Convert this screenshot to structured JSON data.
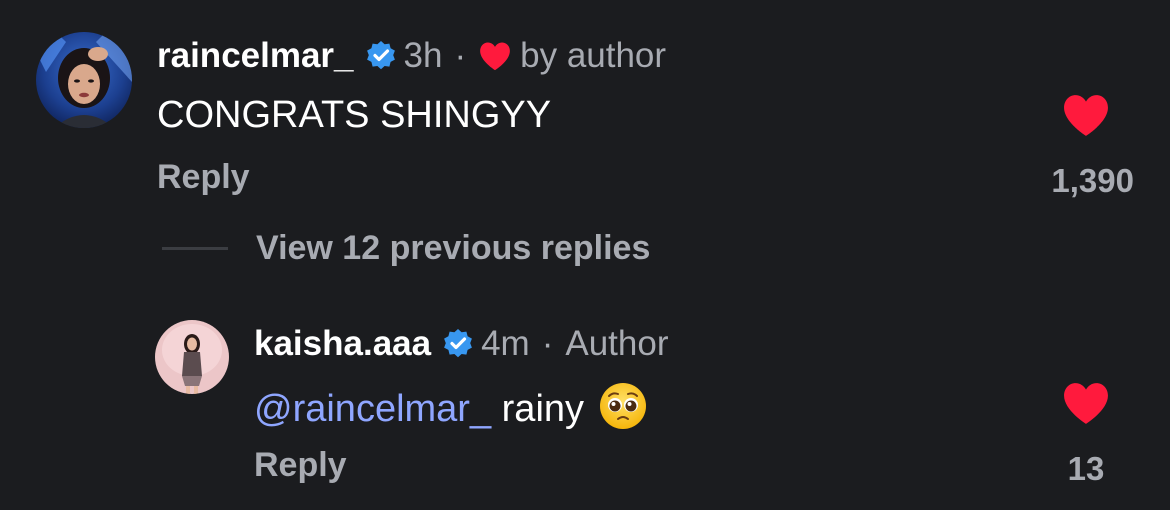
{
  "colors": {
    "background": "#1b1c1f",
    "secondary_text": "#a8abb2",
    "mention": "#8fa6ff",
    "heart": "#ff1a3d",
    "verified": "#3897f0"
  },
  "comments": [
    {
      "username": "raincelmar_",
      "verified": true,
      "time": "3h",
      "separator": "·",
      "liked_by_author_icon": "heart-icon",
      "liked_by_author_label": "by author",
      "text": "CONGRATS SHINGYY",
      "reply_label": "Reply",
      "like_icon": "heart-filled-icon",
      "like_count": "1,390"
    },
    {
      "username": "kaisha.aaa",
      "verified": true,
      "time": "4m",
      "separator": "·",
      "author_badge": "Author",
      "mention": "@raincelmar_",
      "text": " rainy",
      "emoji": "pleading-face-emoji",
      "reply_label": "Reply",
      "like_icon": "heart-filled-icon",
      "like_count": "13"
    }
  ],
  "view_replies_label": "View 12 previous replies"
}
